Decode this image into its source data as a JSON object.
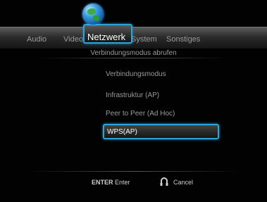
{
  "tabs": [
    {
      "label": "Audio"
    },
    {
      "label": "Video"
    },
    {
      "label": "Netzwerk"
    },
    {
      "label": "System"
    },
    {
      "label": "Sonstiges"
    }
  ],
  "active_tab": "Netzwerk",
  "subtitle": "Verbindungsmodus abrufen",
  "menu": {
    "heading": "Verbindungsmodus",
    "options": [
      "Infrastruktur (AP)",
      "Peer to Peer (Ad Hoc)",
      "WPS(AP)"
    ],
    "selected": "WPS(AP)"
  },
  "footer": {
    "enter_key": "ENTER",
    "enter_label": "Enter",
    "cancel_label": "Cancel"
  },
  "colors": {
    "highlight": "#2aa7d8",
    "background": "#020202"
  }
}
